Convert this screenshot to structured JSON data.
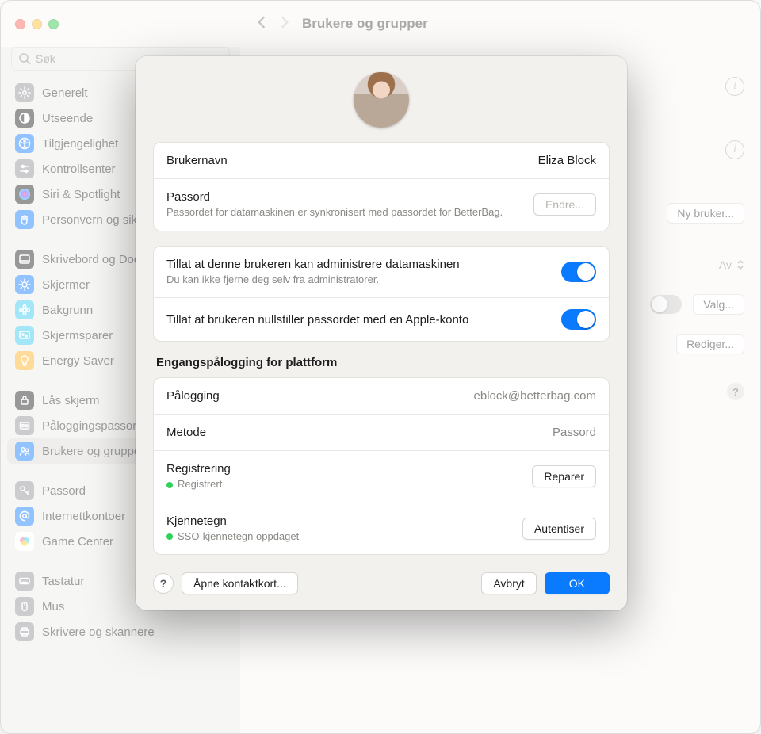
{
  "header": {
    "search_placeholder": "Søk",
    "title": "Brukere og grupper"
  },
  "sidebar": {
    "items": [
      {
        "label": "Generelt",
        "icon": "gear",
        "bg": "#8e8e93"
      },
      {
        "label": "Utseende",
        "icon": "contrast",
        "bg": "#1c1c1e"
      },
      {
        "label": "Tilgjengelighet",
        "icon": "accessibility",
        "bg": "#0a7aff"
      },
      {
        "label": "Kontrollsenter",
        "icon": "sliders",
        "bg": "#8e8e93"
      },
      {
        "label": "Siri & Spotlight",
        "icon": "siri",
        "bg": "#1c1c1e"
      },
      {
        "label": "Personvern og sikkerhet",
        "icon": "hand",
        "bg": "#0a7aff"
      },
      {
        "label": "",
        "icon": "",
        "bg": ""
      },
      {
        "label": "Skrivebord og Dock",
        "icon": "dock",
        "bg": "#1c1c1e"
      },
      {
        "label": "Skjermer",
        "icon": "sun",
        "bg": "#0a7aff"
      },
      {
        "label": "Bakgrunn",
        "icon": "flower",
        "bg": "#34c7ee"
      },
      {
        "label": "Skjermsparer",
        "icon": "screensaver",
        "bg": "#34c7ee"
      },
      {
        "label": "Energy Saver",
        "icon": "bulb",
        "bg": "#ffb020"
      },
      {
        "label": "",
        "icon": "",
        "bg": ""
      },
      {
        "label": "Lås skjerm",
        "icon": "lock",
        "bg": "#1c1c1e"
      },
      {
        "label": "Påloggingspassord",
        "icon": "badge",
        "bg": "#8e8e93"
      },
      {
        "label": "Brukere og grupper",
        "icon": "users",
        "bg": "#0a7aff"
      },
      {
        "label": "",
        "icon": "",
        "bg": ""
      },
      {
        "label": "Passord",
        "icon": "key",
        "bg": "#8e8e93"
      },
      {
        "label": "Internettkontoer",
        "icon": "at",
        "bg": "#0a7aff"
      },
      {
        "label": "Game Center",
        "icon": "gamecenter",
        "bg": "#fff"
      },
      {
        "label": "",
        "icon": "",
        "bg": ""
      },
      {
        "label": "Tastatur",
        "icon": "keyboard",
        "bg": "#8e8e93"
      },
      {
        "label": "Mus",
        "icon": "mouse",
        "bg": "#8e8e93"
      },
      {
        "label": "Skrivere og skannere",
        "icon": "printer",
        "bg": "#8e8e93"
      }
    ],
    "selected_index": 15
  },
  "background_actions": {
    "new_user": "Ny bruker...",
    "off_value": "Av",
    "options": "Valg...",
    "edit": "Rediger..."
  },
  "modal": {
    "username_label": "Brukernavn",
    "username_value": "Eliza Block",
    "password_label": "Passord",
    "password_sub": "Passordet for datamaskinen er synkronisert med passordet for BetterBag.",
    "change_btn": "Endre...",
    "admin_label": "Tillat at denne brukeren kan administrere datamaskinen",
    "admin_sub": "Du kan ikke fjerne deg selv fra administratorer.",
    "reset_label": "Tillat at brukeren nullstiller passordet med en Apple-konto",
    "sso_title": "Engangspålogging for plattform",
    "login_label": "Pålogging",
    "login_value": "eblock@betterbag.com",
    "method_label": "Metode",
    "method_value": "Passord",
    "reg_label": "Registrering",
    "reg_status": "Registrert",
    "repair_btn": "Reparer",
    "token_label": "Kjennetegn",
    "token_status": "SSO-kjennetegn oppdaget",
    "auth_btn": "Autentiser",
    "contact_btn": "Åpne kontaktkort...",
    "cancel_btn": "Avbryt",
    "ok_btn": "OK"
  }
}
